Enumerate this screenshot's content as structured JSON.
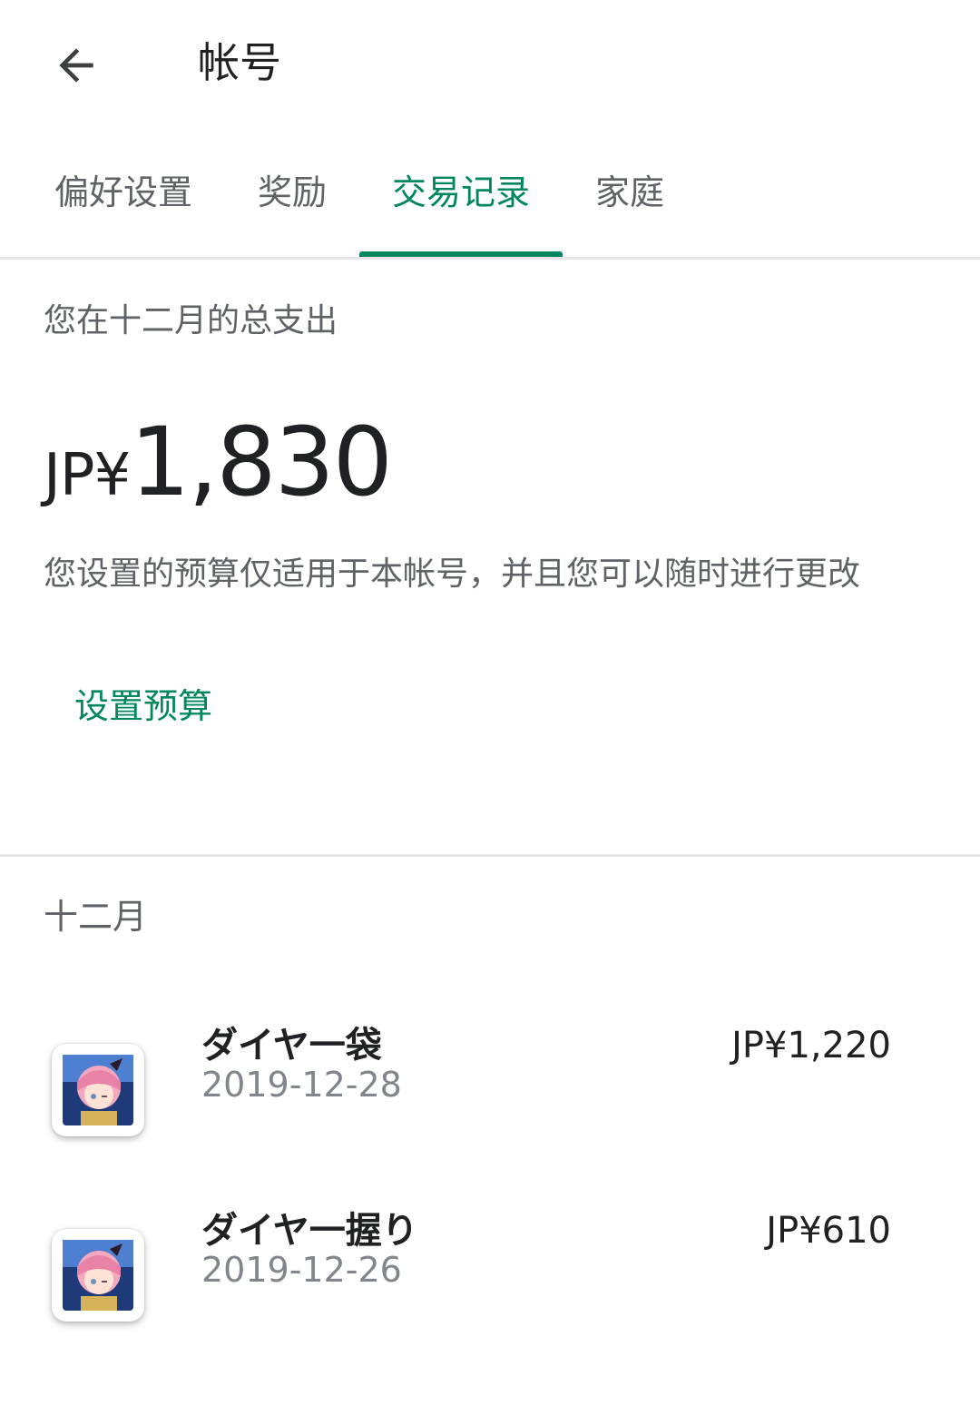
{
  "appbar": {
    "back_icon": "arrow-back-icon",
    "title": "帐号"
  },
  "tabs": [
    {
      "label": "偏好设置",
      "active": false
    },
    {
      "label": "奖励",
      "active": false
    },
    {
      "label": "交易记录",
      "active": true
    },
    {
      "label": "家庭",
      "active": false
    }
  ],
  "summary": {
    "label": "您在十二月的总支出",
    "currency": "JP¥",
    "amount": "1,830",
    "note": "您设置的预算仅适用于本帐号，并且您可以随时进行更改",
    "set_budget_label": "设置预算"
  },
  "month": {
    "label": "十二月",
    "transactions": [
      {
        "title": "ダイヤ一袋",
        "date": "2019-12-28",
        "price": "JP¥1,220",
        "icon": "game-app-icon"
      },
      {
        "title": "ダイヤ一握り",
        "date": "2019-12-26",
        "price": "JP¥610",
        "icon": "game-app-icon"
      }
    ]
  },
  "colors": {
    "accent": "#01875f",
    "text_primary": "#202124",
    "text_secondary": "#5f6368",
    "divider": "#e6e6e6"
  }
}
